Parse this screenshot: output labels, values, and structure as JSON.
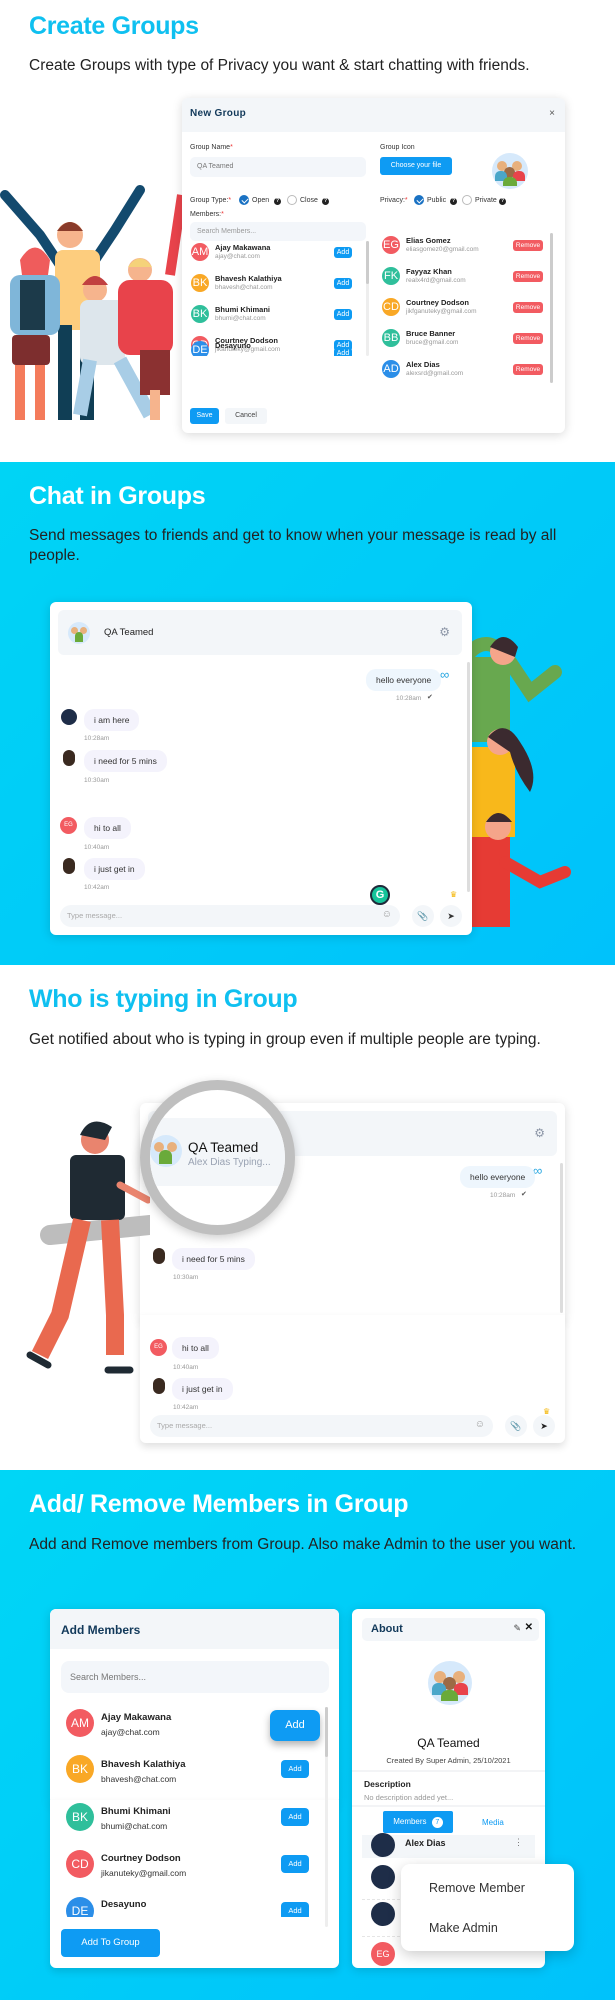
{
  "section1": {
    "title": "Create Groups",
    "description": "Create Groups with type of Privacy you want & start chatting with friends.",
    "modal": {
      "title": "New Group",
      "close_label": "×",
      "group_name_label": "Group Name",
      "group_name_value": "QA Teamed",
      "group_icon_label": "Group Icon",
      "choose_file_label": "Choose your file",
      "group_type_label": "Group Type:",
      "group_type_options": [
        "Open",
        "Close"
      ],
      "group_type_selected": "Open",
      "privacy_label": "Privacy:",
      "privacy_options": [
        "Public",
        "Private"
      ],
      "privacy_selected": "Public",
      "members_label": "Members:",
      "search_placeholder": "Search Members...",
      "required_mark": "*",
      "help_mark": "?",
      "add_label": "Add",
      "remove_label": "Remove",
      "save_label": "Save",
      "cancel_label": "Cancel",
      "available_members": [
        {
          "initials": "AM",
          "name": "Ajay Makawana",
          "email": "ajay@chat.com",
          "color": "#f25b61"
        },
        {
          "initials": "BK",
          "name": "Bhavesh Kalathiya",
          "email": "bhavesh@chat.com",
          "color": "#f9a826"
        },
        {
          "initials": "BK",
          "name": "Bhumi Khimani",
          "email": "bhumi@chat.com",
          "color": "#2fbf9b"
        },
        {
          "initials": "CD",
          "name": "Courtney Dodson",
          "email": "jikanuteky@gmail.com",
          "color": "#f25b61"
        },
        {
          "initials": "DE",
          "name": "Desayuno",
          "email": "",
          "color": "#2b8ee8"
        }
      ],
      "selected_members": [
        {
          "initials": "EG",
          "name": "Elias Gomez",
          "email": "eliasgomez0@gmail.com",
          "color": "#f25b61"
        },
        {
          "initials": "FK",
          "name": "Fayyaz Khan",
          "email": "realx4rd@gmail.com",
          "color": "#2fbf9b"
        },
        {
          "initials": "CD",
          "name": "Courtney Dodson",
          "email": "jikfganuteky@gmail.com",
          "color": "#f9a826"
        },
        {
          "initials": "BB",
          "name": "Bruce Banner",
          "email": "bruce@gmail.com",
          "color": "#2fbf9b"
        },
        {
          "initials": "AD",
          "name": "Alex Dias",
          "email": "alexsrd@gmail.com",
          "color": "#2b8ee8"
        }
      ]
    }
  },
  "section2": {
    "title": "Chat in Groups",
    "description": "Send messages to friends and get to know when your message is read by all people.",
    "chat": {
      "group_name": "QA Teamed",
      "input_placeholder": "Type message...",
      "messages": [
        {
          "text": "hello everyone",
          "time": "10:28am",
          "own": true,
          "read": "✔"
        },
        {
          "text": "i am here",
          "time": "10:28am",
          "own": false,
          "avatar": "photo"
        },
        {
          "text": "i need for 5 mins",
          "time": "10:30am",
          "own": false,
          "avatar": "photo"
        },
        {
          "text": "hi to all",
          "time": "10:40am",
          "own": false,
          "avatar": "EG"
        },
        {
          "text": "i just get in",
          "time": "10:42am",
          "own": false,
          "avatar": "photo"
        }
      ],
      "grammarly_label": "G"
    }
  },
  "section3": {
    "title": "Who is typing in Group",
    "description": "Get notified about who is typing in group even if multiple people are typing.",
    "chat": {
      "group_name": "QA Teamed",
      "typing_status": "Alex Dias Typing...",
      "input_placeholder": "Type message...",
      "messages": [
        {
          "text": "hello everyone",
          "time": "10:28am",
          "own": true,
          "read": "✔"
        },
        {
          "text": "i need for 5 mins",
          "time": "10:30am",
          "own": false
        },
        {
          "text": "hi to all",
          "time": "10:40am",
          "own": false,
          "avatar": "EG"
        },
        {
          "text": "i just get in",
          "time": "10:42am",
          "own": false
        }
      ]
    }
  },
  "section4": {
    "title": "Add/ Remove Members in Group",
    "description": "Add and Remove members from Group. Also make Admin to the user you want.",
    "add_members": {
      "title": "Add Members",
      "search_placeholder": "Search Members...",
      "add_label": "Add",
      "add_to_group_label": "Add To Group",
      "members": [
        {
          "initials": "AM",
          "name": "Ajay Makawana",
          "email": "ajay@chat.com",
          "color": "#f25b61"
        },
        {
          "initials": "BK",
          "name": "Bhavesh Kalathiya",
          "email": "bhavesh@chat.com",
          "color": "#f9a826"
        },
        {
          "initials": "BK",
          "name": "Bhumi Khimani",
          "email": "bhumi@chat.com",
          "color": "#2fbf9b"
        },
        {
          "initials": "CD",
          "name": "Courtney Dodson",
          "email": "jikanuteky@gmail.com",
          "color": "#f25b61"
        },
        {
          "initials": "DE",
          "name": "Desayuno",
          "email": "",
          "color": "#2b8ee8"
        }
      ]
    },
    "about": {
      "title": "About",
      "group_name": "QA Teamed",
      "created_by": "Created By Super Admin, 25/10/2021",
      "description_label": "Description",
      "description_value": "No description added yet...",
      "tab_members": "Members",
      "members_count": "7",
      "tab_media": "Media",
      "first_member": "Alex Dias",
      "last_member_initials": "EG",
      "context_menu": [
        "Remove Member",
        "Make Admin"
      ]
    }
  }
}
